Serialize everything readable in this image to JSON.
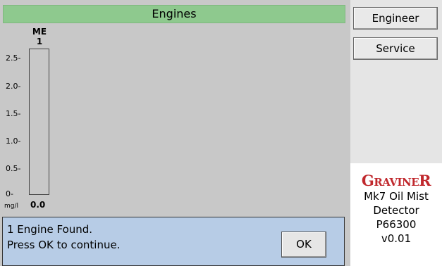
{
  "title": "Engines",
  "chart": {
    "y_ticks": [
      "2.5-",
      "2.0-",
      "1.5-",
      "1.0-",
      "0.5-",
      "0-"
    ],
    "unit": "mg/l",
    "engine": {
      "group": "ME",
      "number": "1",
      "value": "0.0"
    }
  },
  "message": {
    "line1": "1 Engine Found.",
    "line2": "Press OK to continue.",
    "ok_label": "OK"
  },
  "side": {
    "engineer_label": "Engineer",
    "service_label": "Service",
    "brand_G": "G",
    "brand_rest": "RAVINE",
    "brand_R": "R",
    "product_line1": "Mk7 Oil Mist",
    "product_line2": "Detector",
    "part_number": "P66300",
    "version": "v0.01"
  },
  "colors": {
    "title_bar": "#8ec98e",
    "message_bg": "#b7cce6",
    "brand": "#c0282d"
  }
}
